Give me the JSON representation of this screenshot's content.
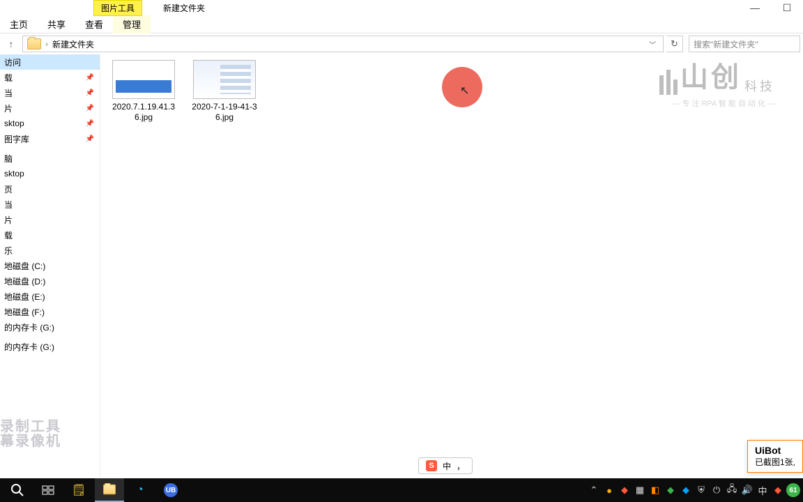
{
  "titlebar": {
    "context_tab": "图片工具",
    "window_title": "新建文件夹"
  },
  "ribbon": {
    "tabs": [
      "主页",
      "共享",
      "查看",
      "管理"
    ]
  },
  "address": {
    "up_tooltip": "上一级",
    "path_current": "新建文件夹",
    "search_placeholder": "搜索\"新建文件夹\""
  },
  "sidebar": {
    "quick_access": "访问",
    "pinned": [
      "载",
      "当",
      "片",
      "sktop",
      "图字库"
    ],
    "group2": [
      "脑",
      "sktop",
      "页",
      "当",
      "片",
      "载",
      "乐"
    ],
    "drives": [
      "地磁盘 (C:)",
      "地磁盘 (D:)",
      "地磁盘 (E:)",
      "地磁盘 (F:)",
      "的内存卡 (G:)"
    ],
    "drives2": [
      "的内存卡 (G:)"
    ]
  },
  "files": [
    {
      "name_line": "2020.7.1.19.41.36.jpg",
      "thumb": "blue"
    },
    {
      "name_line": "2020-7-1-19-41-36.jpg",
      "thumb": "web"
    }
  ],
  "brand": {
    "text": "山创",
    "suffix": "科技",
    "tagline": "— 专 注 RPA 智 能 自 动 化 —"
  },
  "recorder_wm": {
    "l1": "录制工具",
    "l2": "幕录像机"
  },
  "ime": {
    "label": "中",
    "mode": "，"
  },
  "toast": {
    "title": "UiBot",
    "body": "已截图1张,"
  },
  "tray": {
    "lang": "中",
    "clock_badge": "61"
  }
}
